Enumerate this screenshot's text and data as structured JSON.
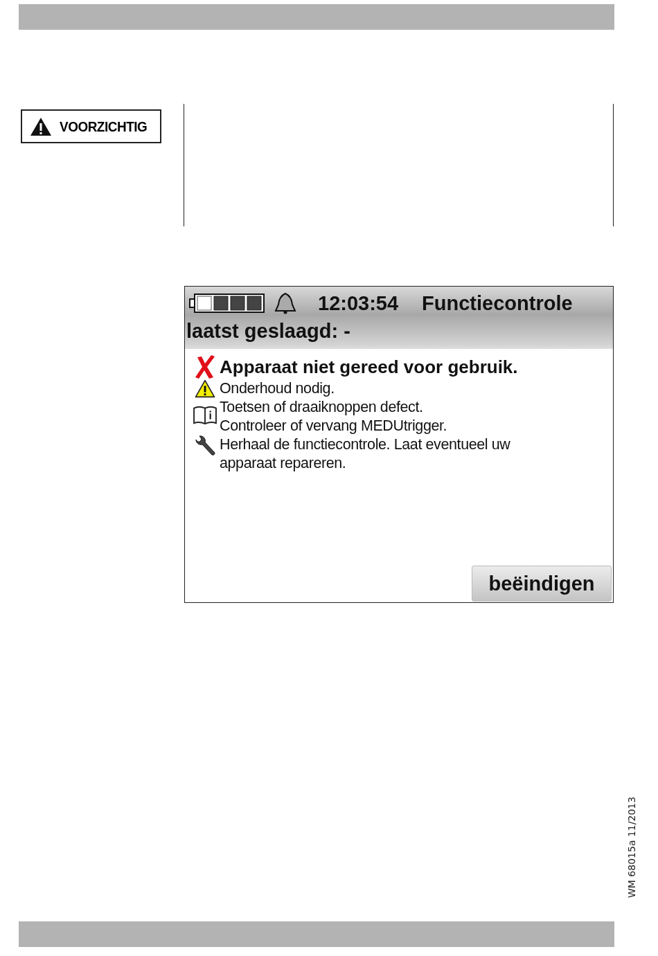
{
  "caution_label": "VOORZICHTIG",
  "device_screen": {
    "time": "12:03:54",
    "title": "Functiecontrole",
    "subtitle": "laatst geslaagd: -",
    "headline": {
      "kind": "error",
      "text": "Apparaat niet gereed voor gebruik."
    },
    "groups": [
      {
        "kind": "warning",
        "lines": [
          "Onderhoud nodig."
        ]
      },
      {
        "kind": "manual",
        "lines": [
          "Toetsen of draaiknoppen defect.",
          "Controleer of vervang MEDUtrigger."
        ]
      },
      {
        "kind": "wrench",
        "lines": [
          "Herhaal de functiecontrole. Laat eventueel uw apparaat repareren."
        ]
      }
    ],
    "button": "beëindigen"
  },
  "document_code": "WM 68015a 11/2013"
}
